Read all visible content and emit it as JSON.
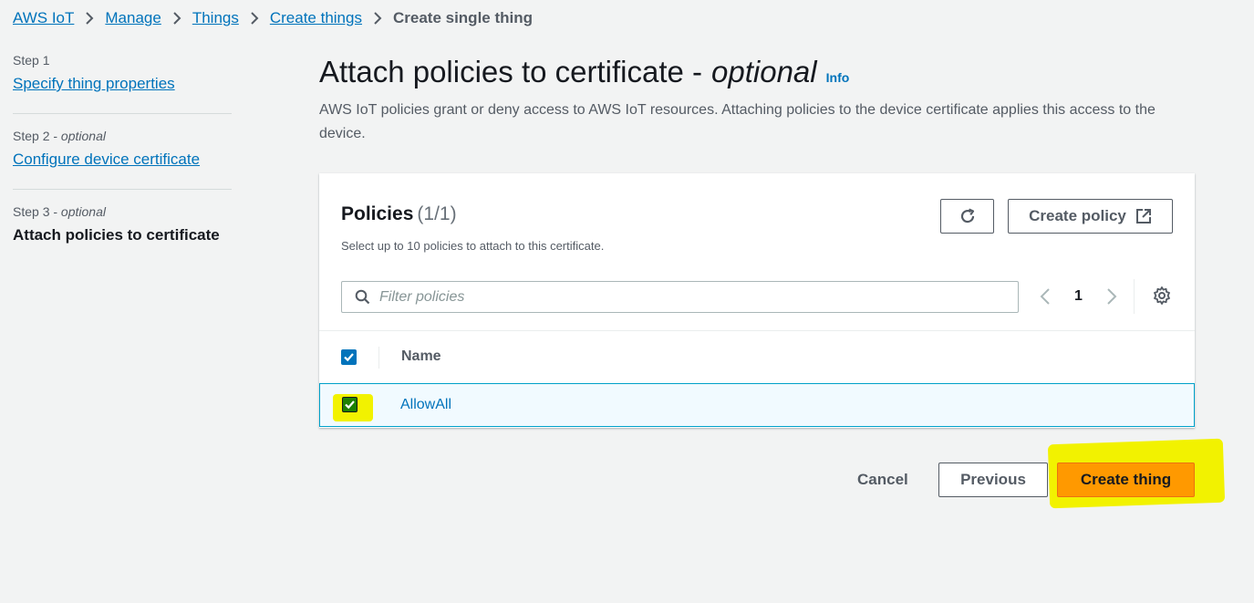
{
  "breadcrumb": {
    "items": [
      "AWS IoT",
      "Manage",
      "Things",
      "Create things"
    ],
    "current": "Create single thing"
  },
  "steps": [
    {
      "num": "Step 1",
      "optional": "",
      "label": "Specify thing properties"
    },
    {
      "num": "Step 2 - ",
      "optional": "optional",
      "label": "Configure device certificate"
    },
    {
      "num": "Step 3 - ",
      "optional": "optional",
      "label": "Attach policies to certificate"
    }
  ],
  "page": {
    "title": "Attach policies to certificate -",
    "title_optional": "optional",
    "info": "Info",
    "description": "AWS IoT policies grant or deny access to AWS IoT resources. Attaching policies to the device certificate applies this access to the device."
  },
  "panel": {
    "title": "Policies",
    "count": "(1/1)",
    "description": "Select up to 10 policies to attach to this certificate.",
    "create_policy_label": "Create policy",
    "refresh_icon": "refresh-icon",
    "external_icon": "external-link-icon",
    "search_placeholder": "Filter policies",
    "search_value": "",
    "page_number": "1",
    "column_name": "Name",
    "rows": [
      {
        "name": "AllowAll",
        "selected": true
      }
    ]
  },
  "footer": {
    "cancel_label": "Cancel",
    "previous_label": "Previous",
    "create_label": "Create thing"
  },
  "colors": {
    "link": "#0073bb",
    "primary": "#ff9900",
    "highlight": "#f2f200",
    "background": "#f2f3f3"
  }
}
